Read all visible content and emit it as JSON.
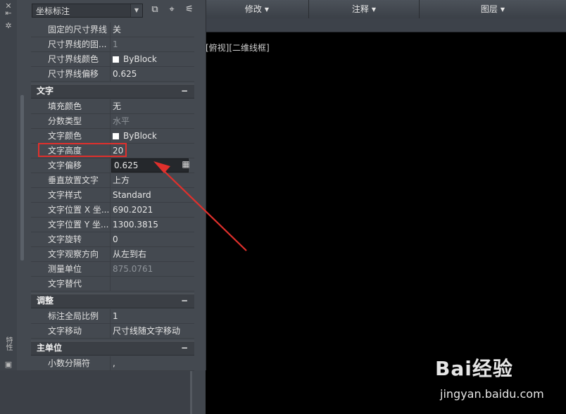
{
  "menus": [
    {
      "label": "修改"
    },
    {
      "label": "注释"
    },
    {
      "label": "图层"
    }
  ],
  "viewport_label": "[俯视][二维线框]",
  "left_strip": {
    "vertical_label": "特性"
  },
  "palette": {
    "selector_value": "坐标标注",
    "rows_top": [
      {
        "key": "固定的尺寸界线",
        "value": "关"
      },
      {
        "key": "尺寸界线的固...",
        "value": "1",
        "dim": true
      },
      {
        "key": "尺寸界线颜色",
        "value": "ByBlock",
        "swatch": true
      },
      {
        "key": "尺寸界线偏移",
        "value": "0.625"
      }
    ],
    "cat_text": {
      "title": "文字",
      "toggle": "−"
    },
    "rows_text": [
      {
        "key": "填充颜色",
        "value": "无"
      },
      {
        "key": "分数类型",
        "value": "水平",
        "dim": true
      },
      {
        "key": "文字颜色",
        "value": "ByBlock",
        "swatch": true
      },
      {
        "key": "文字高度",
        "value": "20"
      },
      {
        "key": "文字偏移",
        "value": "0.625"
      },
      {
        "key": "垂直放置文字",
        "value": "上方"
      },
      {
        "key": "文字样式",
        "value": "Standard"
      },
      {
        "key": "文字位置 X 坐...",
        "value": "690.2021"
      },
      {
        "key": "文字位置 Y 坐...",
        "value": "1300.3815"
      },
      {
        "key": "文字旋转",
        "value": "0"
      },
      {
        "key": "文字观察方向",
        "value": "从左到右"
      },
      {
        "key": "测量单位",
        "value": "875.0761",
        "dim": true
      },
      {
        "key": "文字替代",
        "value": ""
      }
    ],
    "cat_adjust": {
      "title": "调整",
      "toggle": "−"
    },
    "rows_adjust": [
      {
        "key": "标注全局比例",
        "value": "1"
      },
      {
        "key": "文字移动",
        "value": "尺寸线随文字移动"
      }
    ],
    "cat_units": {
      "title": "主单位",
      "toggle": "−"
    },
    "rows_units": [
      {
        "key": "小数分隔符",
        "value": ","
      }
    ]
  },
  "watermark": {
    "brand": "Bai经验",
    "url": "jingyan.baidu.com"
  },
  "colors": {
    "highlight": "#e0302c",
    "accent": "#e0302c"
  }
}
